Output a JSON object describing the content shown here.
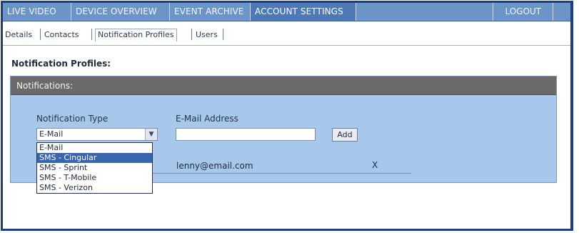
{
  "nav": {
    "tabs": [
      {
        "label": "LIVE VIDEO"
      },
      {
        "label": "DEVICE OVERVIEW"
      },
      {
        "label": "EVENT ARCHIVE"
      },
      {
        "label": "ACCOUNT SETTINGS"
      }
    ],
    "active_tab": "ACCOUNT SETTINGS",
    "logout_label": "LOGOUT"
  },
  "subnav": {
    "items": [
      {
        "label": "Details"
      },
      {
        "label": "Contacts"
      },
      {
        "label": "Notification Profiles"
      },
      {
        "label": "Users"
      }
    ],
    "active_item": "Notification Profiles"
  },
  "page": {
    "section_title": "Notification Profiles:"
  },
  "panel": {
    "header": "Notifications:",
    "notification_type_label": "Notification Type",
    "email_label": "E-Mail Address",
    "select_value": "E-Mail",
    "email_input_value": "",
    "add_label": "Add",
    "options": [
      {
        "label": "E-Mail"
      },
      {
        "label": "SMS - Cingular"
      },
      {
        "label": "SMS - Sprint"
      },
      {
        "label": "SMS - T-Mobile"
      },
      {
        "label": "SMS - Verizon"
      }
    ],
    "highlighted_option": "SMS - Cingular",
    "entries": [
      {
        "email": "lenny@email.com",
        "remove": "X"
      }
    ]
  },
  "colors": {
    "nav_bg": "#6b94c7",
    "nav_active": "#4e79b6",
    "frame_border": "#1c3f7d",
    "panel_bg": "#a8c8eb",
    "panel_header_bg": "#6a6a6a",
    "option_highlight": "#3a64ad"
  },
  "icons": {
    "select_arrow": "chevron-down-icon"
  }
}
